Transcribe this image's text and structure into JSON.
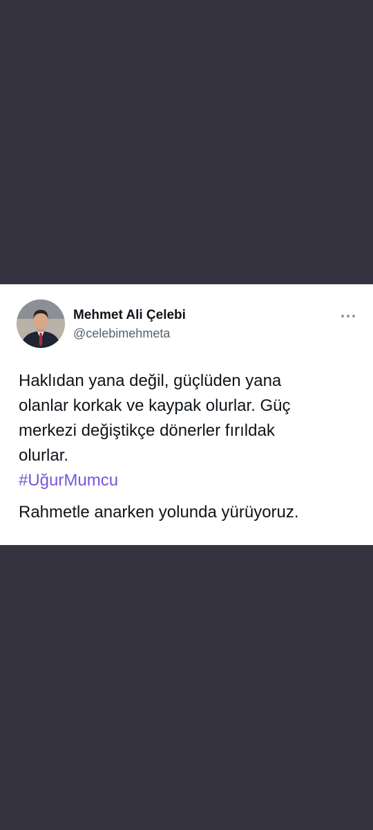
{
  "tweet": {
    "author": {
      "display_name": "Mehmet Ali Çelebi",
      "handle": "@celebimehmeta",
      "avatar_icon": "avatar-photo"
    },
    "more_icon": "more-horizontal-icon",
    "text_lines": [
      "Haklıdan yana değil, güçlüden yana",
      "olanlar korkak ve kaypak olurlar. Güç",
      "merkezi değiştikçe dönerler fırıldak",
      "olurlar."
    ],
    "hashtag": "#UğurMumcu",
    "closing_line": "Rahmetle anarken yolunda yürüyoruz."
  },
  "colors": {
    "background": "#363441",
    "card": "#ffffff",
    "text": "#0f1419",
    "muted": "#536471",
    "hashtag": "#7856d8"
  }
}
